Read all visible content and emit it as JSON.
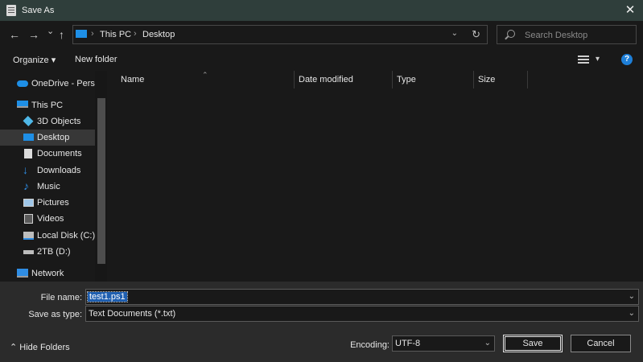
{
  "window": {
    "title": "Save As",
    "close_glyph": "✕"
  },
  "nav": {
    "back_glyph": "←",
    "forward_glyph": "→",
    "recent_glyph": "⌄",
    "up_glyph": "↑",
    "address": {
      "crumbs": [
        "This PC",
        "Desktop"
      ],
      "separator": "›"
    },
    "search_placeholder": "Search Desktop"
  },
  "toolbar": {
    "organize": "Organize ▾",
    "new_folder": "New folder",
    "view_chev": "▾",
    "help": "?"
  },
  "sidebar": {
    "items": [
      {
        "label": "OneDrive - Persor",
        "icon": "onedrive-icon",
        "color": "#1e8fe6"
      },
      {
        "label": "This PC",
        "icon": "pc-icon",
        "color": "#1e8fe6"
      },
      {
        "label": "3D Objects",
        "icon": "cube-icon",
        "color": "#4fb8e8"
      },
      {
        "label": "Desktop",
        "icon": "desktop-icon",
        "color": "#1e8fe6",
        "selected": true
      },
      {
        "label": "Documents",
        "icon": "document-icon",
        "color": "#dcdcdc"
      },
      {
        "label": "Downloads",
        "icon": "download-icon",
        "color": "#2f8de4"
      },
      {
        "label": "Music",
        "icon": "music-icon",
        "color": "#2f8de4"
      },
      {
        "label": "Pictures",
        "icon": "pictures-icon",
        "color": "#9fc6e8"
      },
      {
        "label": "Videos",
        "icon": "video-icon",
        "color": "#cfcfcf"
      },
      {
        "label": "Local Disk (C:)",
        "icon": "disk-icon",
        "color": "#bdbdbd"
      },
      {
        "label": "2TB (D:)",
        "icon": "drive-icon",
        "color": "#bdbdbd"
      },
      {
        "label": "Network",
        "icon": "network-icon",
        "color": "#2f8de4"
      }
    ]
  },
  "columns": [
    "Name",
    "Date modified",
    "Type",
    "Size"
  ],
  "form": {
    "file_name_label": "File name:",
    "file_name_value": "test1.ps1",
    "save_type_label": "Save as type:",
    "save_type_value": "Text Documents (*.txt)",
    "encoding_label": "Encoding:",
    "encoding_value": "UTF-8",
    "chev": "⌄"
  },
  "footer": {
    "hide_folders": "⌃  Hide Folders",
    "save": "Save",
    "cancel": "Cancel"
  }
}
